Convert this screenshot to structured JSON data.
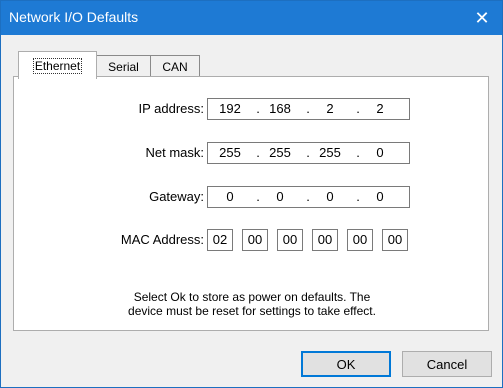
{
  "window": {
    "title": "Network I/O Defaults",
    "close_glyph": "✕"
  },
  "tabs": [
    {
      "label": "Ethernet",
      "active": true
    },
    {
      "label": "Serial",
      "active": false
    },
    {
      "label": "CAN",
      "active": false
    }
  ],
  "fields": {
    "ip": {
      "label": "IP address:",
      "octets": [
        "192",
        "168",
        "2",
        "2"
      ]
    },
    "mask": {
      "label": "Net mask:",
      "octets": [
        "255",
        "255",
        "255",
        "0"
      ]
    },
    "gateway": {
      "label": "Gateway:",
      "octets": [
        "0",
        "0",
        "0",
        "0"
      ]
    },
    "mac": {
      "label": "MAC Address:",
      "bytes": [
        "02",
        "00",
        "00",
        "00",
        "00",
        "00"
      ]
    }
  },
  "note": {
    "line1": "Select Ok to store as power on defaults. The",
    "line2": "device must be reset for settings to take effect."
  },
  "buttons": {
    "ok_label": "OK",
    "cancel_label": "Cancel"
  },
  "colors": {
    "titlebar": "#1e7ad4",
    "panel": "#ffffff",
    "dialog": "#f0f0f0",
    "default_button_border": "#0078d7"
  }
}
